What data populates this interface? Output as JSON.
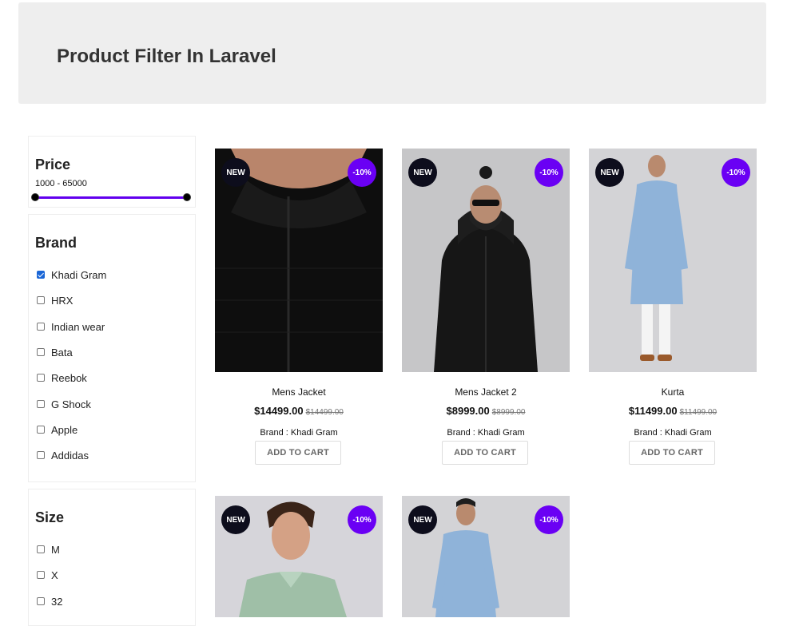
{
  "header": {
    "title": "Product Filter In Laravel"
  },
  "filters": {
    "price": {
      "title": "Price",
      "range": "1000 - 65000",
      "min": 1000,
      "max": 65000
    },
    "brand": {
      "title": "Brand",
      "options": [
        {
          "label": "Khadi Gram",
          "checked": true
        },
        {
          "label": "HRX",
          "checked": false
        },
        {
          "label": "Indian wear",
          "checked": false
        },
        {
          "label": "Bata",
          "checked": false
        },
        {
          "label": "Reebok",
          "checked": false
        },
        {
          "label": "G Shock",
          "checked": false
        },
        {
          "label": "Apple",
          "checked": false
        },
        {
          "label": "Addidas",
          "checked": false
        }
      ]
    },
    "size": {
      "title": "Size",
      "options": [
        {
          "label": "M",
          "checked": false
        },
        {
          "label": "X",
          "checked": false
        },
        {
          "label": "32",
          "checked": false
        }
      ]
    }
  },
  "products": [
    {
      "name": "Mens Jacket",
      "price": "$14499.00",
      "old_price": "$14499.00",
      "brand": "Brand : Khadi Gram",
      "badge_new": "NEW",
      "badge_off": "-10%",
      "cart": "ADD TO CART"
    },
    {
      "name": "Mens Jacket 2",
      "price": "$8999.00",
      "old_price": "$8999.00",
      "brand": "Brand : Khadi Gram",
      "badge_new": "NEW",
      "badge_off": "-10%",
      "cart": "ADD TO CART"
    },
    {
      "name": "Kurta",
      "price": "$11499.00",
      "old_price": "$11499.00",
      "brand": "Brand : Khadi Gram",
      "badge_new": "NEW",
      "badge_off": "-10%",
      "cart": "ADD TO CART"
    },
    {
      "badge_new": "NEW",
      "badge_off": "-10%"
    },
    {
      "badge_new": "NEW",
      "badge_off": "-10%"
    }
  ],
  "colors": {
    "accent": "#6200ee",
    "badge_new": "#0d0d1c",
    "badge_off": "#6a00f4",
    "header_bg": "#eeeeee"
  }
}
